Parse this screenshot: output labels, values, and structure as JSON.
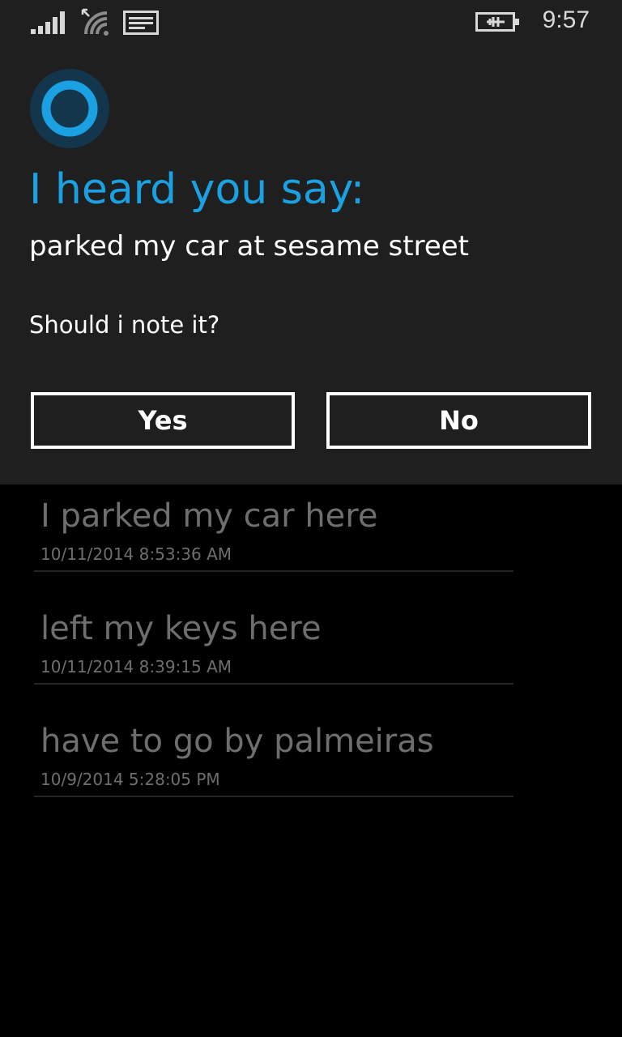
{
  "status_bar": {
    "icons": [
      "signal-strength-icon",
      "wifi-icon",
      "message-icon",
      "battery-charging-icon"
    ],
    "time": "9:57"
  },
  "dialog": {
    "icon": "cortana-icon",
    "accent_color": "#1ba1e2",
    "headline": "I heard you say:",
    "heard_text": "parked my car at sesame street",
    "question": "Should i note it?",
    "yes_label": "Yes",
    "no_label": "No"
  },
  "notes": [
    {
      "title": "I parked my car here",
      "date": "10/11/2014 8:53:36 AM"
    },
    {
      "title": "left my keys here",
      "date": "10/11/2014 8:39:15 AM"
    },
    {
      "title": "have to go by palmeiras",
      "date": "10/9/2014 5:28:05 PM"
    }
  ]
}
